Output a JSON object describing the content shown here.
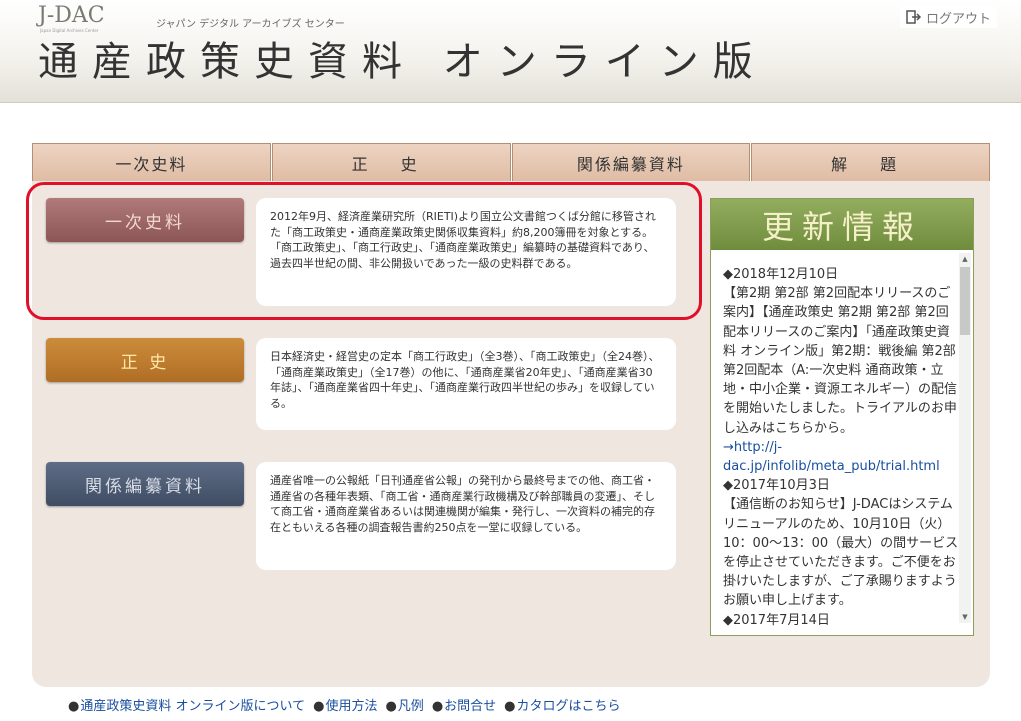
{
  "header": {
    "logo_main": "J-DAC",
    "logo_sub": "Japan Digital Archives Center",
    "logo_kana": "ジャパン デジタル アーカイブズ センター",
    "title": "通産政策史資料 オンライン版",
    "logout_label": "ログアウト"
  },
  "tabs": [
    {
      "label": "一次史料"
    },
    {
      "label": "正 史"
    },
    {
      "label": "関係編纂資料"
    },
    {
      "label": "解 題"
    }
  ],
  "sections": [
    {
      "button": "一次史料",
      "text": "2012年9月、経済産業研究所（RIETI)より国立公文書館つくば分館に移管された「商工政策史・通商産業政策史関係収集資料」約8,200簿冊を対象とする。「商工政策史」、「商工行政史」、「通商産業政策史」編纂時の基礎資料であり、過去四半世紀の間、非公開扱いであった一級の史料群である。"
    },
    {
      "button": "正 史",
      "text": "日本経済史・経営史の定本「商工行政史」（全3巻）、「商工政策史」（全24巻）、「通商産業政策史」（全17巻）の他に、「通商産業省20年史」、「通商産業省30年誌」、「通商産業省四十年史」、「通商産業行政四半世紀の歩み」を収録している。"
    },
    {
      "button": "関係編纂資料",
      "text": "通産省唯一の公報紙「日刊通産省公報」の発刊から最終号までの他、商工省・通産省の各種年表類、「商工省・通商産業行政機構及び幹部職員の変遷」、そして商工省・通商産業省あるいは関連機関が編集・発行し、一次資料の補完的存在ともいえる各種の調査報告書約250点を一堂に収録している。"
    }
  ],
  "news": {
    "title": "更新情報",
    "items": [
      {
        "date": "◆2018年12月10日",
        "body": "【第2期 第2部 第2回配本リリースのご案内】【通産政策史 第2期 第2部 第2回配本リリースのご案内】「通産政策史資料 オンライン版」第2期：戦後編 第2部 第2回配本（A:一次史料 通商政策・立地・中小企業・資源エネルギー）の配信を開始いたしました。トライアルのお申し込みはこちらから。",
        "link": "→http://j-dac.jp/infolib/meta_pub/trial.html"
      },
      {
        "date": "◆2017年10月3日",
        "body": "【通信断のお知らせ】J-DACはシステムリニューアルのため、10月10日（火）10：00～13：00（最大）の間サービスを停止させていただきます。ご不便をお掛けいたしますが、ご了承賜りますようお願い申し上げます。",
        "link": ""
      },
      {
        "date": "◆2017年7月14日",
        "body": "",
        "link": ""
      }
    ]
  },
  "footer": [
    {
      "label": "通産政策史資料 オンライン版について"
    },
    {
      "label": "使用方法"
    },
    {
      "label": "凡例"
    },
    {
      "label": "お問合せ"
    },
    {
      "label": "カタログはこちら"
    }
  ]
}
